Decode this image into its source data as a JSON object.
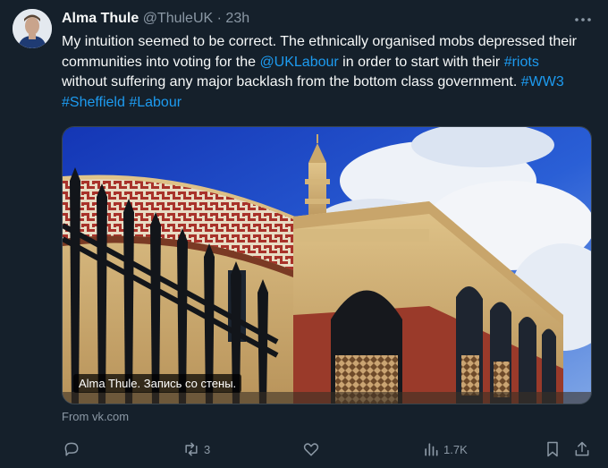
{
  "author": {
    "name": "Alma Thule",
    "handle": "@ThuleUK",
    "separator": "·",
    "time": "23h"
  },
  "tweet": {
    "text_1": "My intuition seemed to be correct. The ethnically organised mobs depressed their communities into voting for the ",
    "mention": "@UKLabour",
    "text_2": " in order to start with their ",
    "hashtag_riots": "#riots",
    "text_3": " without suffering any major backlash from the bottom class government. ",
    "hashtag_ww3": "#WW3",
    "hashtag_sheffield": "#Sheffield",
    "hashtag_labour": "#Labour"
  },
  "media": {
    "caption": "Alma Thule. Запись со стены."
  },
  "source": "From vk.com",
  "actions": {
    "reply_icon": "reply-icon",
    "retweet_icon": "retweet-icon",
    "retweet_count": "3",
    "like_icon": "heart-icon",
    "views_icon": "views-icon",
    "views_count": "1.7K",
    "bookmark_icon": "bookmark-icon",
    "share_icon": "share-icon"
  },
  "colors": {
    "background": "#15202b",
    "text": "#f7f9f9",
    "muted": "#8b98a5",
    "link": "#1d9bf0"
  }
}
